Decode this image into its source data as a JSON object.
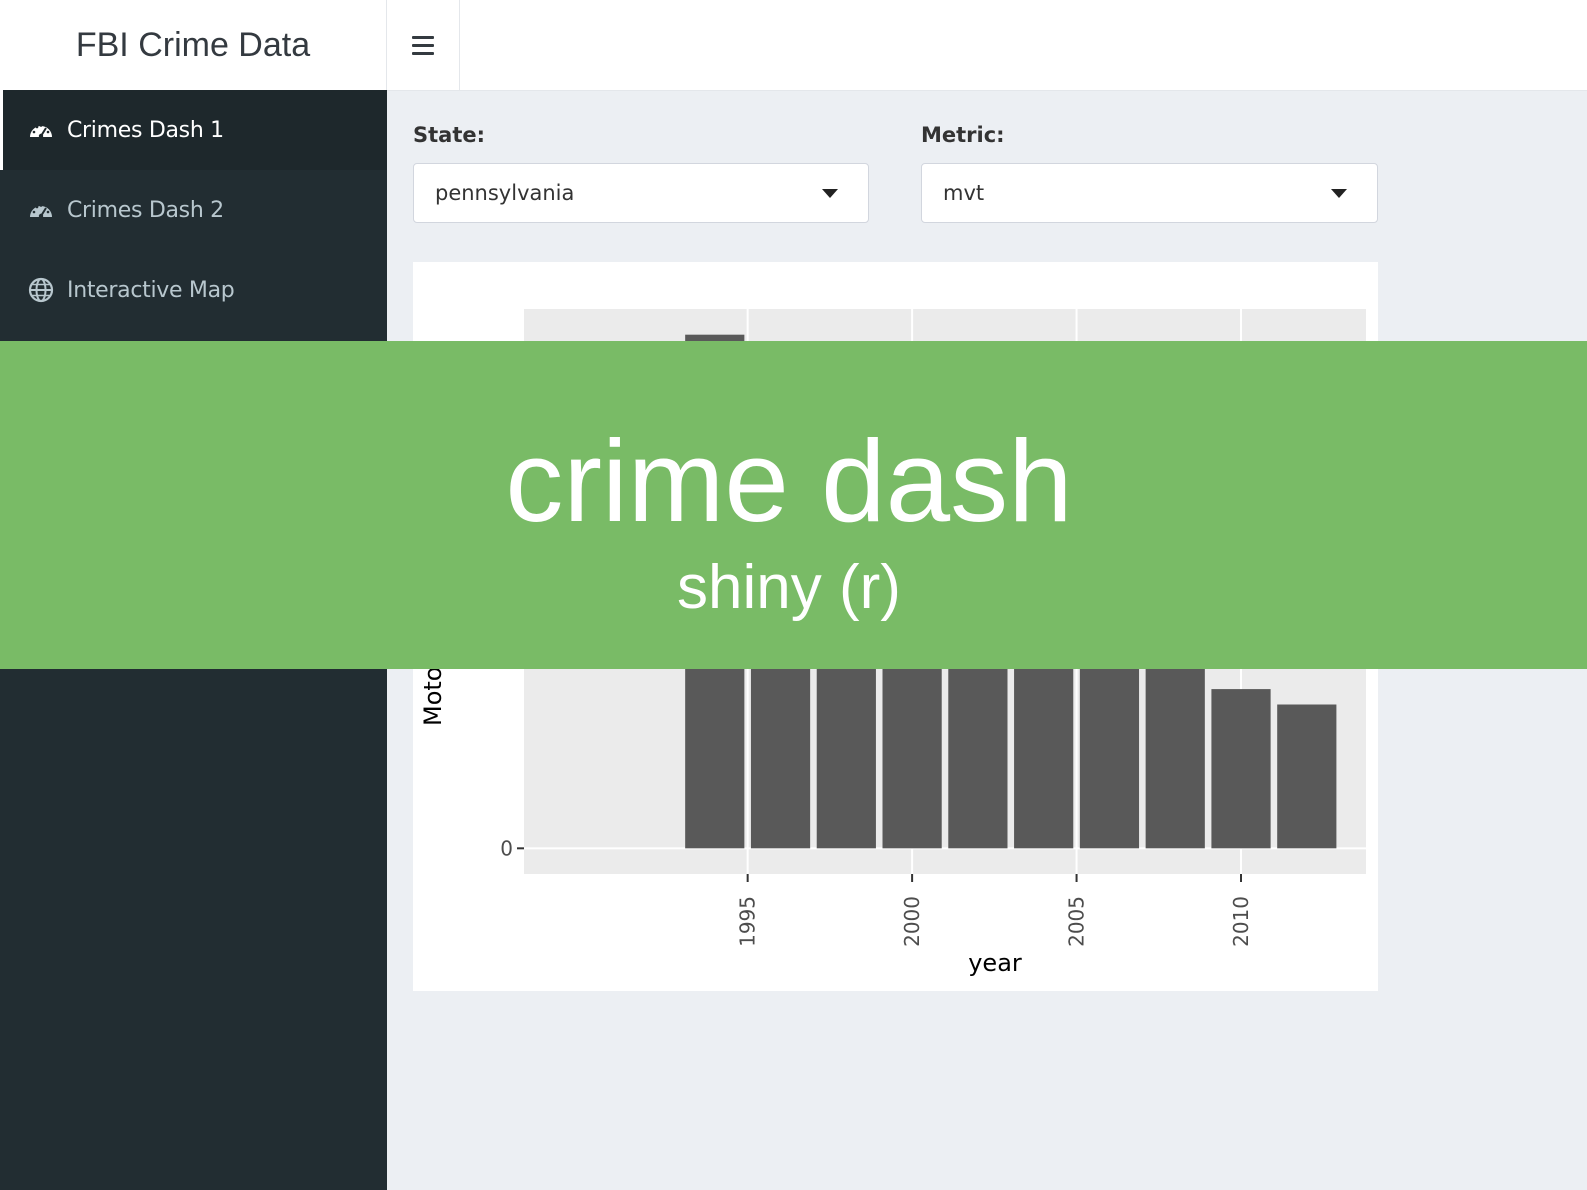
{
  "header": {
    "brand": "FBI Crime Data",
    "menu_icon": "hamburger-menu-icon"
  },
  "sidebar": {
    "items": [
      {
        "label": "Crimes Dash 1",
        "icon": "dashboard-gauge-icon",
        "active": true
      },
      {
        "label": "Crimes Dash 2",
        "icon": "dashboard-gauge-icon",
        "active": false
      },
      {
        "label": "Interactive Map",
        "icon": "globe-icon",
        "active": false
      }
    ]
  },
  "controls": {
    "state": {
      "label": "State:",
      "value": "pennsylvania"
    },
    "metric": {
      "label": "Metric:",
      "value": "mvt"
    }
  },
  "chart_data": {
    "type": "bar",
    "x": [
      1994,
      1996,
      1998,
      2000,
      2002,
      2004,
      2006,
      2008,
      2010,
      2012
    ],
    "values": [
      100,
      96,
      92,
      90,
      88,
      85,
      80,
      70,
      31,
      28
    ],
    "xlabel": "year",
    "ylabel": "Moto",
    "x_ticks": [
      "1995",
      "2000",
      "2005",
      "2010"
    ],
    "y_ticks": [
      "0"
    ],
    "ylim": [
      -5,
      105
    ],
    "xlim": [
      1988.2,
      2013.8
    ],
    "bar_color": "#595959",
    "panel_color": "#ebebeb",
    "grid": true,
    "legend": "none"
  },
  "banner": {
    "title": "crime dash",
    "subtitle": "shiny (r)",
    "color": "#79bb66"
  }
}
